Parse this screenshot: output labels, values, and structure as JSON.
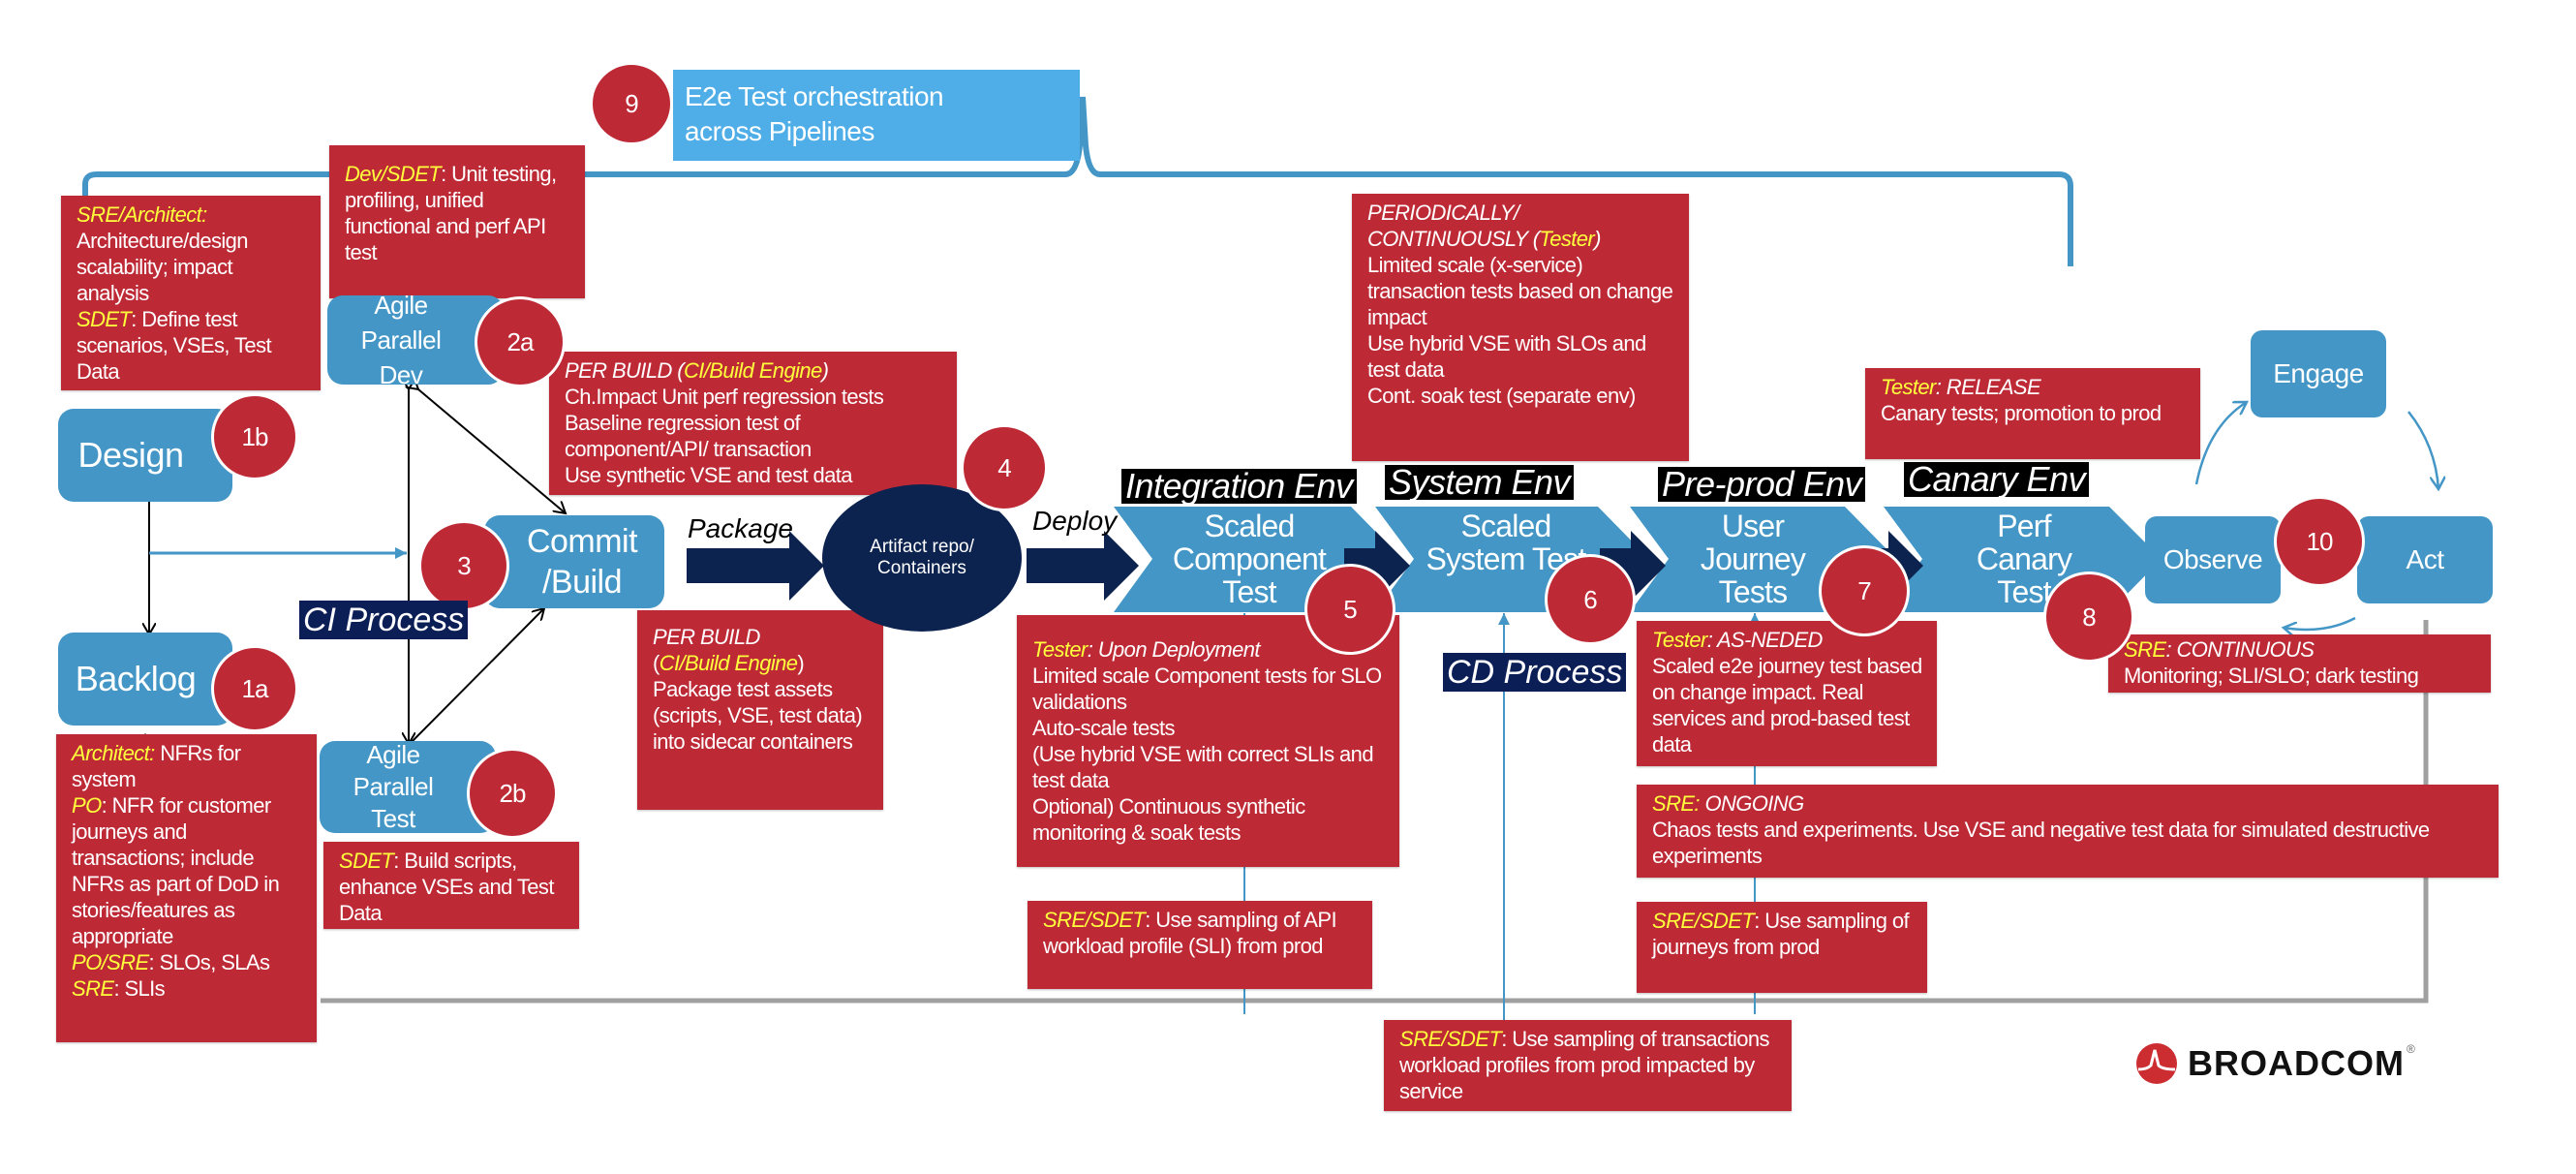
{
  "colors": {
    "red": "#bd2a36",
    "blue": "#4396c6",
    "navy": "#0c2350",
    "orchestration_blue": "#4faee8",
    "role_yellow": "#ffff3c"
  },
  "orchestration": {
    "number": "9",
    "label_line1": "E2e Test orchestration",
    "label_line2": "across Pipelines"
  },
  "nodes": {
    "design": {
      "label": "Design",
      "number": "1b"
    },
    "backlog": {
      "label": "Backlog",
      "number": "1a"
    },
    "agile_dev": {
      "label": "Agile Parallel Dev",
      "number": "2a"
    },
    "agile_test": {
      "label": "Agile Parallel Test",
      "number": "2b"
    },
    "commit": {
      "label": "Commit /Build",
      "number": "3"
    },
    "artifact": {
      "label": "Artifact repo/ Containers",
      "number": "4"
    },
    "observe": {
      "label": "Observe"
    },
    "engage": {
      "label": "Engage"
    },
    "act": {
      "label": "Act"
    },
    "loop_number": "10"
  },
  "process_labels": {
    "ci": "CI Process",
    "cd": "CD Process"
  },
  "flow_labels": {
    "package": "Package",
    "deploy": "Deploy"
  },
  "stages": [
    {
      "env": "Integration Env",
      "label": "Scaled Component Test",
      "number": "5"
    },
    {
      "env": "System Env",
      "label": "Scaled System Test",
      "number": "6"
    },
    {
      "env": "Pre-prod Env",
      "label": "User Journey Tests",
      "number": "7"
    },
    {
      "env": "Canary Env",
      "label": "Perf Canary Test",
      "number": "8"
    }
  ],
  "notes": {
    "sre_architect": [
      [
        {
          "t": "SRE/Architect:",
          "s": "y"
        }
      ],
      [
        {
          "t": "Architecture/design scalability; impact analysis",
          "s": ""
        }
      ],
      [
        {
          "t": "SDET",
          "s": "y"
        },
        {
          "t": ": Define test scenarios, VSEs, Test Data",
          "s": ""
        }
      ]
    ],
    "dev_sdet": [
      [
        {
          "t": "Dev/SDET",
          "s": "y"
        },
        {
          "t": ": Unit testing, profiling, unified functional and perf API test",
          "s": ""
        }
      ]
    ],
    "architect": [
      [
        {
          "t": "Architect:",
          "s": "y"
        },
        {
          "t": " NFRs for system",
          "s": ""
        }
      ],
      [
        {
          "t": "PO",
          "s": "y"
        },
        {
          "t": ": NFR for customer journeys and transactions; include NFRs as part of DoD in stories/features as appropriate",
          "s": ""
        }
      ],
      [
        {
          "t": "PO/SRE",
          "s": "y"
        },
        {
          "t": ": SLOs, SLAs",
          "s": ""
        }
      ],
      [
        {
          "t": "SRE",
          "s": "y"
        },
        {
          "t": ": SLIs",
          "s": ""
        }
      ]
    ],
    "sdet_build": [
      [
        {
          "t": "SDET",
          "s": "y"
        },
        {
          "t": ": Build scripts, enhance VSEs and Test Data",
          "s": ""
        }
      ]
    ],
    "per_build_1": [
      [
        {
          "t": "PER BUILD (",
          "s": "i"
        },
        {
          "t": "CI/Build Engine",
          "s": "y"
        },
        {
          "t": ")",
          "s": "i"
        }
      ],
      [
        {
          "t": "Ch.Impact Unit perf regression tests",
          "s": ""
        }
      ],
      [
        {
          "t": "Baseline regression test of component/API/ transaction",
          "s": ""
        }
      ],
      [
        {
          "t": "Use synthetic VSE and test data",
          "s": ""
        }
      ]
    ],
    "per_build_2": [
      [
        {
          "t": "PER BUILD",
          "s": "i"
        }
      ],
      [
        {
          "t": "(",
          "s": ""
        },
        {
          "t": "CI/Build Engine",
          "s": "y"
        },
        {
          "t": ")",
          "s": ""
        }
      ],
      [
        {
          "t": "Package test assets (scripts, VSE, test data) into sidecar containers",
          "s": ""
        }
      ]
    ],
    "periodically": [
      [
        {
          "t": "PERIODICALLY/ CONTINUOUSLY (",
          "s": "i"
        },
        {
          "t": "Tester",
          "s": "y"
        },
        {
          "t": ")",
          "s": "i"
        }
      ],
      [
        {
          "t": "Limited scale (x-service) transaction tests based on change impact",
          "s": ""
        }
      ],
      [
        {
          "t": "Use hybrid VSE with SLOs and test data",
          "s": ""
        }
      ],
      [
        {
          "t": "Cont. soak test (separate env)",
          "s": ""
        }
      ]
    ],
    "tester_release": [
      [
        {
          "t": "Tester",
          "s": "y"
        },
        {
          "t": ": RELEASE",
          "s": "i"
        }
      ],
      [
        {
          "t": "Canary tests; promotion to prod",
          "s": ""
        }
      ]
    ],
    "sre_continuous": [
      [
        {
          "t": "SRE",
          "s": "y"
        },
        {
          "t": ": CONTINUOUS",
          "s": "i"
        }
      ],
      [
        {
          "t": "Monitoring; SLI/SLO; dark testing",
          "s": ""
        }
      ]
    ],
    "tester_deploy": [
      [
        {
          "t": "Tester",
          "s": "y"
        },
        {
          "t": ": Upon Deployment",
          "s": "i"
        }
      ],
      [
        {
          "t": "Limited scale Component  tests for SLO validations",
          "s": ""
        }
      ],
      [
        {
          "t": "Auto-scale tests",
          "s": ""
        }
      ],
      [
        {
          "t": "(Use hybrid VSE with correct SLIs and test data",
          "s": ""
        }
      ],
      [
        {
          "t": "Optional) Continuous synthetic monitoring & soak tests",
          "s": ""
        }
      ]
    ],
    "tester_asneded": [
      [
        {
          "t": "Tester",
          "s": "y"
        },
        {
          "t": ": AS-NEDED",
          "s": "i"
        }
      ],
      [
        {
          "t": "Scaled e2e journey test based on change impact. Real services and prod-based test data",
          "s": ""
        }
      ]
    ],
    "sre_ongoing": [
      [
        {
          "t": "SRE: ",
          "s": "y"
        },
        {
          "t": "ONGOING",
          "s": "i"
        }
      ],
      [
        {
          "t": "Chaos tests and experiments. Use VSE and negative test data for simulated destructive experiments",
          "s": ""
        }
      ]
    ],
    "sre_sdet_api": [
      [
        {
          "t": "SRE/SDET",
          "s": "y"
        },
        {
          "t": ": Use sampling of API workload profile (SLI) from prod",
          "s": ""
        }
      ]
    ],
    "sre_sdet_journeys": [
      [
        {
          "t": "SRE/SDET",
          "s": "y"
        },
        {
          "t": ": Use sampling of  journeys from prod",
          "s": ""
        }
      ]
    ],
    "sre_sdet_transactions": [
      [
        {
          "t": "SRE/SDET",
          "s": "y"
        },
        {
          "t": ": Use sampling of transactions workload profiles from prod impacted by service",
          "s": ""
        }
      ]
    ]
  },
  "logo": {
    "text": "BROADCOM",
    "mark": "®"
  }
}
